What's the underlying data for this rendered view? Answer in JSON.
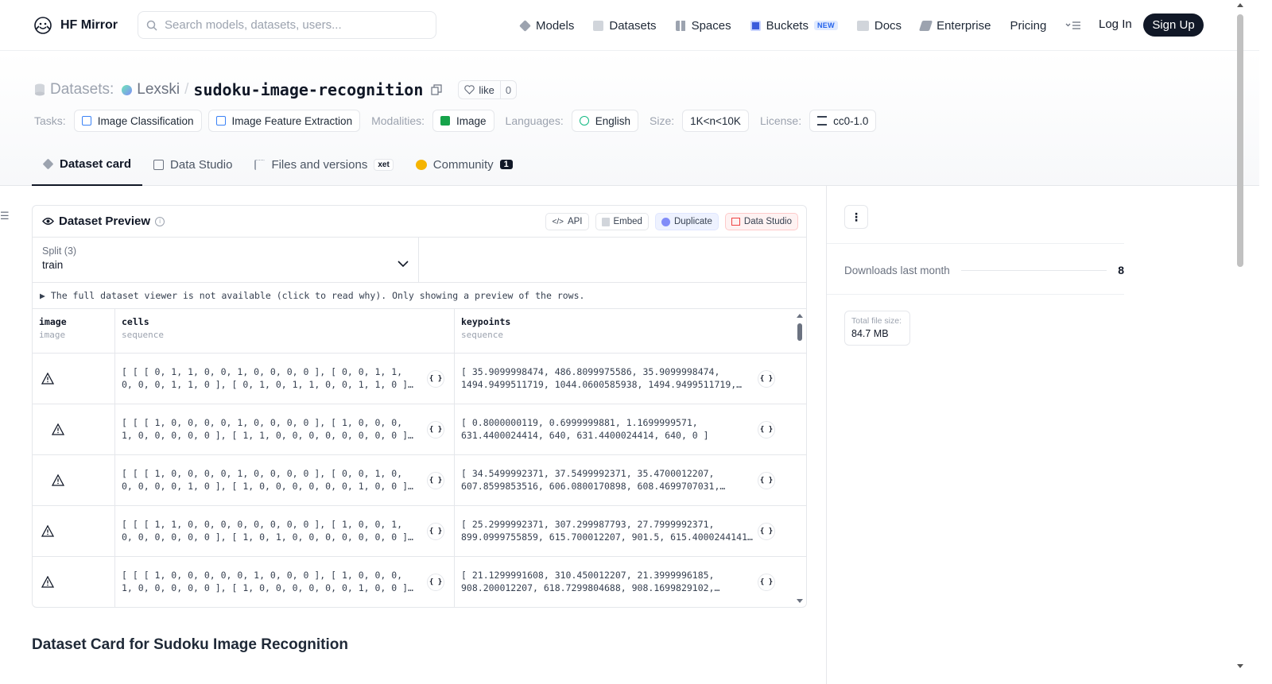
{
  "brand": {
    "name": "HF Mirror"
  },
  "search": {
    "placeholder": "Search models, datasets, users..."
  },
  "nav": {
    "items": [
      {
        "label": "Models",
        "icon": "cube-icon"
      },
      {
        "label": "Datasets",
        "icon": "database-icon"
      },
      {
        "label": "Spaces",
        "icon": "grid-icon"
      },
      {
        "label": "Buckets",
        "icon": "bucket-icon",
        "badge": "NEW"
      },
      {
        "label": "Docs",
        "icon": "book-icon"
      },
      {
        "label": "Enterprise",
        "icon": "enterprise-icon"
      },
      {
        "label": "Pricing"
      }
    ],
    "login": "Log In",
    "signup": "Sign Up"
  },
  "repo": {
    "type_label": "Datasets:",
    "owner": "Lexski",
    "separator": "/",
    "name": "sudoku-image-recognition",
    "like_label": "like",
    "like_count": "0"
  },
  "tags": {
    "tasks_label": "Tasks:",
    "tasks": [
      "Image Classification",
      "Image Feature Extraction"
    ],
    "modalities_label": "Modalities:",
    "modalities": [
      "Image"
    ],
    "languages_label": "Languages:",
    "languages": [
      "English"
    ],
    "size_label": "Size:",
    "size": "1K<n<10K",
    "license_label": "License:",
    "license": "cc0-1.0"
  },
  "tabs": [
    {
      "label": "Dataset card",
      "active": true
    },
    {
      "label": "Data Studio"
    },
    {
      "label": "Files and versions",
      "badge": "xet"
    },
    {
      "label": "Community",
      "count": "1"
    }
  ],
  "preview": {
    "title": "Dataset Preview",
    "actions": {
      "api": "API",
      "embed": "Embed",
      "duplicate": "Duplicate",
      "data_studio": "Data Studio"
    },
    "split_label": "Split (3)",
    "split_value": "train",
    "notice": "▶ The full dataset viewer is not available (click to read why). Only showing a preview of the rows.",
    "columns": [
      {
        "name": "image",
        "type": "image"
      },
      {
        "name": "cells",
        "type": "sequence"
      },
      {
        "name": "keypoints",
        "type": "sequence"
      }
    ],
    "rows": [
      {
        "cells": "[ [ [ 0, 1, 1, 0, 0, 1, 0, 0, 0, 0 ], [ 0, 0, 1, 1,\n0, 0, 0, 1, 1, 0 ], [ 0, 1, 0, 1, 1, 0, 0, 1, 1, 0 ]…",
        "keypoints": "[ 35.9099998474, 486.8099975586, 35.9099998474,\n1494.9499511719, 1044.0600585938, 1494.9499511719,…"
      },
      {
        "cells": "[ [ [ 1, 0, 0, 0, 0, 1, 0, 0, 0, 0 ], [ 1, 0, 0, 0,\n1, 0, 0, 0, 0, 0 ], [ 1, 1, 0, 0, 0, 0, 0, 0, 0, 0 ]…",
        "keypoints": "[ 0.8000000119, 0.6999999881, 1.1699999571,\n631.4400024414, 640, 631.4400024414, 640, 0 ]"
      },
      {
        "cells": "[ [ [ 1, 0, 0, 0, 0, 1, 0, 0, 0, 0 ], [ 0, 0, 1, 0,\n0, 0, 0, 0, 1, 0 ], [ 1, 0, 0, 0, 0, 0, 0, 1, 0, 0 ]…",
        "keypoints": "[ 34.5499992371, 37.5499992371, 35.4700012207,\n607.8599853516, 606.0800170898, 608.4699707031,…"
      },
      {
        "cells": "[ [ [ 1, 1, 0, 0, 0, 0, 0, 0, 0, 0 ], [ 1, 0, 0, 1,\n0, 0, 0, 0, 0, 0 ], [ 1, 0, 1, 0, 0, 0, 0, 0, 0, 0 ]…",
        "keypoints": "[ 25.2999992371, 307.299987793, 27.7999992371,\n899.0999755859, 615.700012207, 901.5, 615.4000244141…"
      },
      {
        "cells": "[ [ [ 1, 0, 0, 0, 0, 0, 1, 0, 0, 0 ], [ 1, 0, 0, 0,\n1, 0, 0, 0, 0, 0 ], [ 1, 0, 0, 0, 0, 0, 0, 1, 0, 0 ]…",
        "keypoints": "[ 21.1299991608, 310.450012207, 21.3999996185,\n908.200012207, 618.7299804688, 908.1699829102,…"
      }
    ]
  },
  "card": {
    "heading": "Dataset Card for Sudoku Image Recognition"
  },
  "sidebar": {
    "downloads_label": "Downloads last month",
    "downloads_value": "8",
    "size_label": "Total file size:",
    "size_value": "84.7 MB"
  }
}
